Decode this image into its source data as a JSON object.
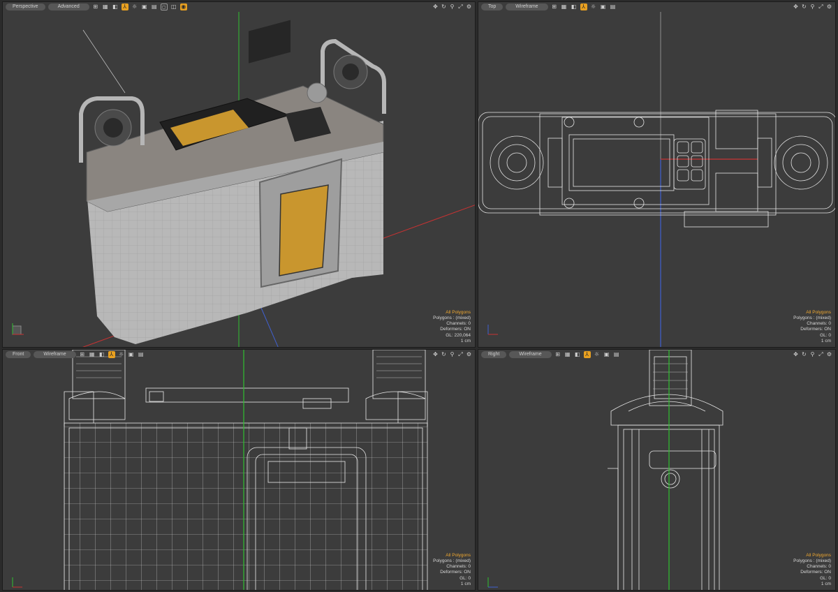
{
  "viewports": {
    "perspective": {
      "view": "Perspective",
      "shading": "Advanced",
      "info": {
        "title": "All Polygons",
        "polygons": "Polygons : (mixed)",
        "channels": "Channels: 0",
        "deformers": "Deformers: ON",
        "gl": "GL: 220,064",
        "unit": "1 cm"
      }
    },
    "top": {
      "view": "Top",
      "shading": "Wireframe",
      "info": {
        "title": "All Polygons",
        "polygons": "Polygons : (mixed)",
        "channels": "Channels: 0",
        "deformers": "Deformers: ON",
        "gl": "GL: 0",
        "unit": "1 cm"
      }
    },
    "front": {
      "view": "Front",
      "shading": "Wireframe",
      "info": {
        "title": "All Polygons",
        "polygons": "Polygons : (mixed)",
        "channels": "Channels: 0",
        "deformers": "Deformers: ON",
        "gl": "GL: 0",
        "unit": "1 cm"
      }
    },
    "right": {
      "view": "Right",
      "shading": "Wireframe",
      "info": {
        "title": "All Polygons",
        "polygons": "Polygons : (mixed)",
        "channels": "Channels: 0",
        "deformers": "Deformers: ON",
        "gl": "GL: 0",
        "unit": "1 cm"
      }
    }
  },
  "icons": {
    "toolbar": [
      "grid-icon",
      "wireframe-icon",
      "solid-icon",
      "texture-icon",
      "light-icon",
      "camera-icon",
      "layers-icon",
      "render-icon"
    ],
    "nav": [
      "move-view-icon",
      "rotate-view-icon",
      "zoom-view-icon",
      "maximize-icon",
      "settings-icon"
    ]
  },
  "colors": {
    "accent": "#e8a020",
    "info_title": "#f0a830",
    "axis_x": "#c83232",
    "axis_y": "#30c030",
    "axis_z": "#4060d0",
    "viewport_bg": "#3c3c3c",
    "panel_yellow": "#c9962e"
  }
}
